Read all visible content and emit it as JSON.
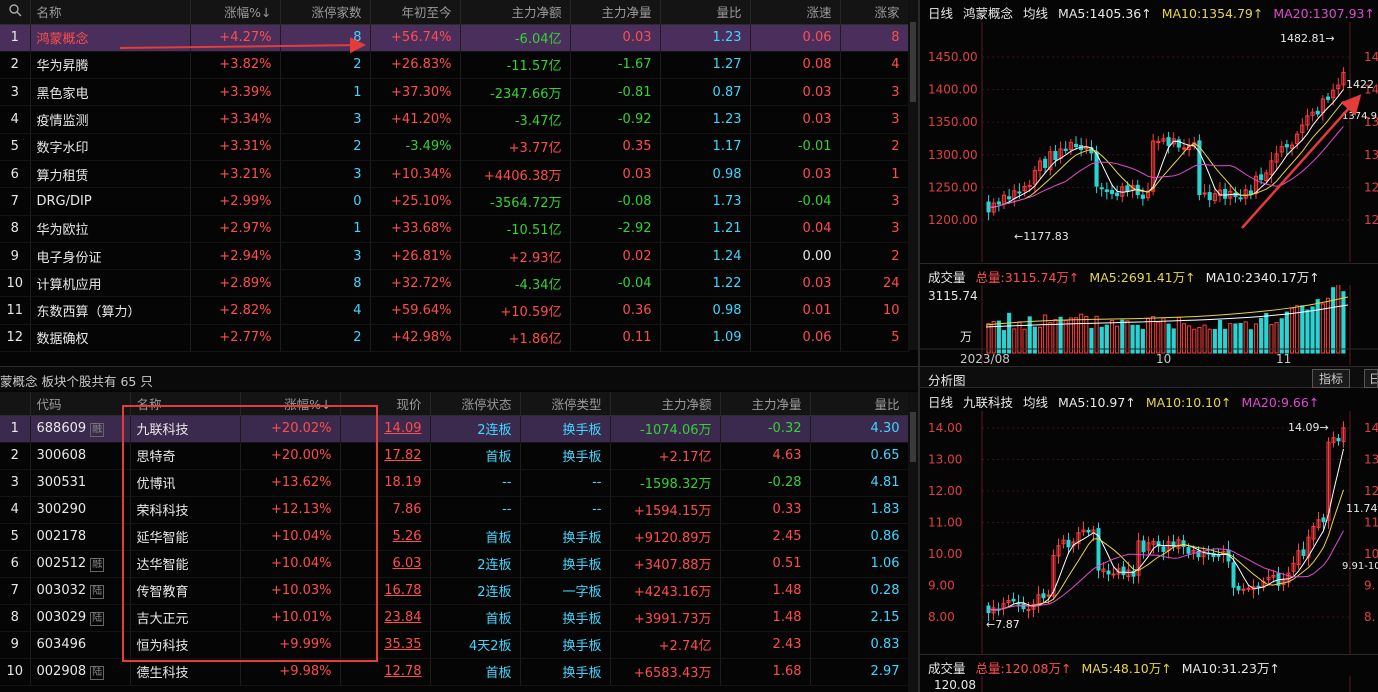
{
  "top_table": {
    "headers": [
      "名称",
      "涨幅%↓",
      "涨停家数",
      "年初至今",
      "主力净额",
      "主力净量",
      "量比",
      "涨速",
      "涨家"
    ],
    "search_icon": "search-icon",
    "rows": [
      {
        "n": "1",
        "name": "鸿蒙概念",
        "pct": "+4.27%",
        "limit": "8",
        "ytd": "+56.74%",
        "net": "-6.04亿",
        "netv": "0.03",
        "ratio": "1.23",
        "speed": "0.06",
        "up": "8"
      },
      {
        "n": "2",
        "name": "华为昇腾",
        "pct": "+3.82%",
        "limit": "2",
        "ytd": "+26.83%",
        "net": "-11.57亿",
        "netv": "-1.67",
        "ratio": "1.27",
        "speed": "0.08",
        "up": "4"
      },
      {
        "n": "3",
        "name": "黑色家电",
        "pct": "+3.39%",
        "limit": "1",
        "ytd": "+37.30%",
        "net": "-2347.66万",
        "netv": "-0.81",
        "ratio": "0.87",
        "speed": "0.03",
        "up": "3"
      },
      {
        "n": "4",
        "name": "疫情监测",
        "pct": "+3.34%",
        "limit": "3",
        "ytd": "+41.20%",
        "net": "-3.47亿",
        "netv": "-0.92",
        "ratio": "1.23",
        "speed": "0.03",
        "up": "3"
      },
      {
        "n": "5",
        "name": "数字水印",
        "pct": "+3.31%",
        "limit": "2",
        "ytd": "-3.49%",
        "net": "+3.77亿",
        "netv": "0.35",
        "ratio": "1.17",
        "speed": "-0.01",
        "up": "2"
      },
      {
        "n": "6",
        "name": "算力租赁",
        "pct": "+3.21%",
        "limit": "3",
        "ytd": "+10.34%",
        "net": "+4406.38万",
        "netv": "0.03",
        "ratio": "0.98",
        "speed": "0.03",
        "up": "1"
      },
      {
        "n": "7",
        "name": "DRG/DIP",
        "pct": "+2.99%",
        "limit": "0",
        "ytd": "+25.10%",
        "net": "-3564.72万",
        "netv": "-0.08",
        "ratio": "1.73",
        "speed": "-0.04",
        "up": "3"
      },
      {
        "n": "8",
        "name": "华为欧拉",
        "pct": "+2.97%",
        "limit": "1",
        "ytd": "+33.68%",
        "net": "-10.51亿",
        "netv": "-2.92",
        "ratio": "1.21",
        "speed": "0.04",
        "up": "3"
      },
      {
        "n": "9",
        "name": "电子身份证",
        "pct": "+2.94%",
        "limit": "3",
        "ytd": "+26.81%",
        "net": "+2.93亿",
        "netv": "0.02",
        "ratio": "1.24",
        "speed": "0.00",
        "up": "2"
      },
      {
        "n": "10",
        "name": "计算机应用",
        "pct": "+2.89%",
        "limit": "8",
        "ytd": "+32.72%",
        "net": "-4.34亿",
        "netv": "-0.04",
        "ratio": "1.22",
        "speed": "0.03",
        "up": "24"
      },
      {
        "n": "11",
        "name": "东数西算（算力）",
        "pct": "+2.82%",
        "limit": "4",
        "ytd": "+59.64%",
        "net": "+10.59亿",
        "netv": "0.36",
        "ratio": "0.98",
        "speed": "0.01",
        "up": "10"
      },
      {
        "n": "12",
        "name": "数据确权",
        "pct": "+2.77%",
        "limit": "2",
        "ytd": "+42.98%",
        "net": "+1.86亿",
        "netv": "0.11",
        "ratio": "1.09",
        "speed": "0.06",
        "up": "5"
      }
    ]
  },
  "mid_bar": {
    "text": "蒙概念  板块个股共有 65 只"
  },
  "bottom_table": {
    "headers": [
      "代码",
      "名称",
      "涨幅%↓",
      "现价",
      "涨停状态",
      "涨停类型",
      "主力净额",
      "主力净量",
      "量比"
    ],
    "rows": [
      {
        "n": "1",
        "code": "688609",
        "tag": "融",
        "name": "九联科技",
        "pct": "+20.02%",
        "price": "14.09",
        "state": "2连板",
        "type": "换手板",
        "net": "-1074.06万",
        "netv": "-0.32",
        "ratio": "4.30"
      },
      {
        "n": "2",
        "code": "300608",
        "tag": "",
        "name": "思特奇",
        "pct": "+20.00%",
        "price": "17.82",
        "state": "首板",
        "type": "换手板",
        "net": "+2.17亿",
        "netv": "4.63",
        "ratio": "0.65"
      },
      {
        "n": "3",
        "code": "300531",
        "tag": "",
        "name": "优博讯",
        "pct": "+13.62%",
        "price": "18.19",
        "state": "--",
        "type": "--",
        "net": "-1598.32万",
        "netv": "-0.28",
        "ratio": "4.81"
      },
      {
        "n": "4",
        "code": "300290",
        "tag": "",
        "name": "荣科科技",
        "pct": "+12.13%",
        "price": "7.86",
        "state": "--",
        "type": "--",
        "net": "+1594.15万",
        "netv": "0.33",
        "ratio": "1.83"
      },
      {
        "n": "5",
        "code": "002178",
        "tag": "",
        "name": "延华智能",
        "pct": "+10.04%",
        "price": "5.26",
        "state": "首板",
        "type": "换手板",
        "net": "+9120.89万",
        "netv": "2.45",
        "ratio": "0.86"
      },
      {
        "n": "6",
        "code": "002512",
        "tag": "融",
        "name": "达华智能",
        "pct": "+10.04%",
        "price": "6.03",
        "state": "2连板",
        "type": "换手板",
        "net": "+3407.88万",
        "netv": "0.51",
        "ratio": "1.06"
      },
      {
        "n": "7",
        "code": "003032",
        "tag": "陆",
        "name": "传智教育",
        "pct": "+10.03%",
        "price": "16.78",
        "state": "2连板",
        "type": "一字板",
        "net": "+4243.16万",
        "netv": "1.48",
        "ratio": "0.28"
      },
      {
        "n": "8",
        "code": "003029",
        "tag": "陆",
        "name": "吉大正元",
        "pct": "+10.01%",
        "price": "23.84",
        "state": "首板",
        "type": "换手板",
        "net": "+3991.73万",
        "netv": "1.48",
        "ratio": "2.15"
      },
      {
        "n": "9",
        "code": "603496",
        "tag": "",
        "name": "恒为科技",
        "pct": "+9.99%",
        "price": "35.35",
        "state": "4天2板",
        "type": "换手板",
        "net": "+2.74亿",
        "netv": "2.43",
        "ratio": "0.83"
      },
      {
        "n": "10",
        "code": "002908",
        "tag": "陆",
        "name": "德生科技",
        "pct": "+9.98%",
        "price": "12.78",
        "state": "首板",
        "type": "换手板",
        "net": "+6583.43万",
        "netv": "1.68",
        "ratio": "2.97"
      }
    ]
  },
  "chart1": {
    "title_left": "日线",
    "name": "鸿蒙概念",
    "avg_label": "均线",
    "ma5": "MA5:1405.36↑",
    "ma10": "MA10:1354.79↑",
    "ma20": "MA20:1307.93↑",
    "y_ticks": [
      "1450.00",
      "1400.00",
      "1350.00",
      "1300.00",
      "1250.00",
      "1200.00"
    ],
    "high_label": "1482.81→",
    "low_label": "←1177.83",
    "last_label": "1422",
    "mid_label": "1374.9",
    "vol_title": "成交量",
    "vol_total": "总量:3115.74万↑",
    "vol_ma5": "MA5:2691.41万↑",
    "vol_ma10": "MA10:2340.17万↑",
    "vol_top": "3115.74",
    "vol_unit": "万",
    "x_labels": [
      "2023/08",
      "10",
      "11"
    ]
  },
  "analysis": {
    "title": "分析图",
    "btn": "指标",
    "btn2": "日"
  },
  "chart2": {
    "title_left": "日线",
    "name": "九联科技",
    "avg_label": "均线",
    "ma5": "MA5:10.97↑",
    "ma10": "MA10:10.10↑",
    "ma20": "MA20:9.66↑",
    "y_ticks": [
      "14.00",
      "13.00",
      "12.00",
      "11.00",
      "10.00",
      "9.00",
      "8.00"
    ],
    "high_label": "14.09→",
    "low_label": "←7.87",
    "last_label": "11.74",
    "mid_label": "9.91-10",
    "vol_title": "成交量",
    "vol_total": "总量:120.08万↑",
    "vol_ma5": "MA5:48.10万↑",
    "vol_ma10": "MA10:31.23万↑",
    "vol_top": "120.08"
  },
  "colors": {
    "up": "#ff4d4d",
    "down": "#35d135",
    "selected": "#4a2f5c",
    "highlight": "#e53b3b"
  }
}
